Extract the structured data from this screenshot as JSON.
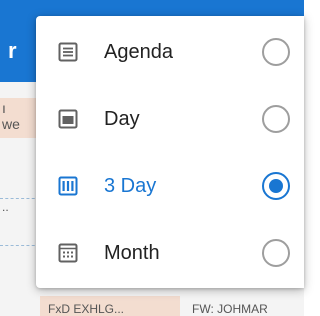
{
  "app_bar": {
    "title_fragment": "r"
  },
  "background": {
    "side_fragment_top": "ı",
    "side_fragment_mid": "we",
    "side_fragment_dots": "..",
    "bottom_fragment_left": "FxD EXHLG...",
    "bottom_fragment_right": "FW: JOHMAR"
  },
  "view_menu": {
    "items": [
      {
        "label": "Agenda",
        "icon": "agenda-icon",
        "selected": false
      },
      {
        "label": "Day",
        "icon": "day-icon",
        "selected": false
      },
      {
        "label": "3 Day",
        "icon": "three-day-icon",
        "selected": true
      },
      {
        "label": "Month",
        "icon": "month-icon",
        "selected": false
      }
    ]
  },
  "colors": {
    "accent": "#1976d2",
    "icon_gray": "#616161",
    "radio_unchecked": "#9e9e9e",
    "text": "#222222"
  }
}
